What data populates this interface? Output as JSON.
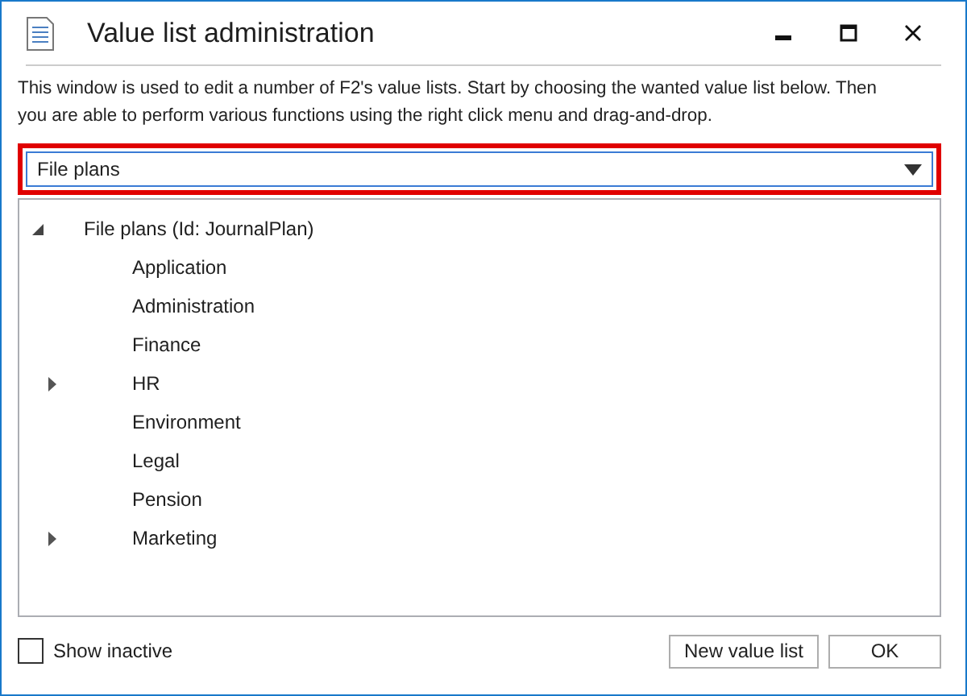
{
  "window": {
    "title": "Value list administration"
  },
  "description": "This window is used to edit a number of F2's value lists. Start by choosing the wanted value list below. Then you are able to perform various functions using the right click menu and drag-and-drop.",
  "dropdown": {
    "value": "File plans",
    "highlighted": true
  },
  "tree": [
    {
      "label": "File plans (Id: JournalPlan)",
      "expanded": true,
      "children": [
        {
          "label": "Application"
        },
        {
          "label": "Administration"
        },
        {
          "label": "Finance"
        },
        {
          "label": "HR",
          "expanded": false
        },
        {
          "label": "Environment"
        },
        {
          "label": "Legal"
        },
        {
          "label": "Pension"
        },
        {
          "label": "Marketing",
          "expanded": false
        }
      ]
    }
  ],
  "show_inactive": {
    "label": "Show inactive",
    "checked": false
  },
  "buttons": [
    "New value list",
    "OK"
  ]
}
